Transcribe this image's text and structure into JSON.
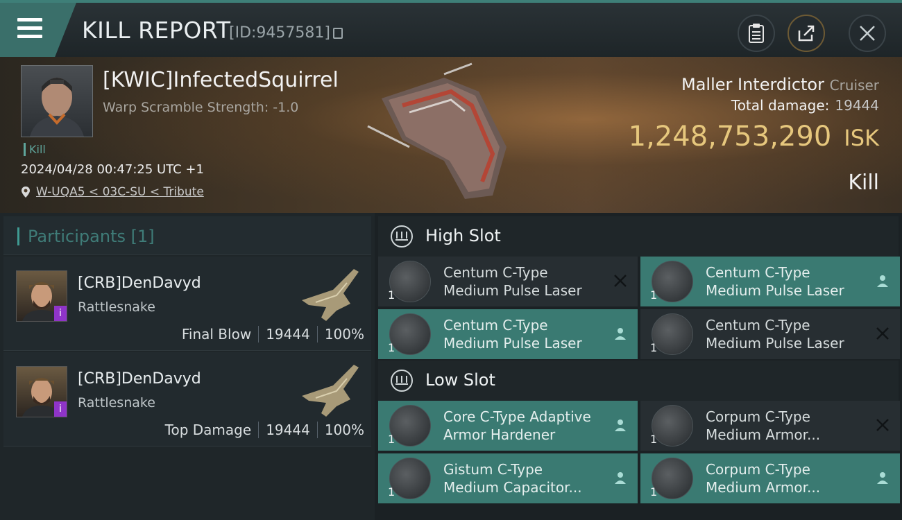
{
  "header": {
    "title": "KILL REPORT",
    "report_id": "[ID:9457581]"
  },
  "victim": {
    "name": "[KWIC]InfectedSquirrel",
    "warp_scramble": "Warp Scramble Strength: -1.0",
    "kill_tag": "Kill",
    "datetime": "2024/04/28 00:47:25 UTC +1",
    "location": "W-UQA5 < 03C-SU < Tribute",
    "ship_name": "Maller Interdictor",
    "ship_class": "Cruiser",
    "total_damage_label": "Total damage:",
    "total_damage": "19444",
    "isk_value": "1,248,753,290",
    "isk_unit": "ISK",
    "result": "Kill"
  },
  "participants": {
    "title": "Participants",
    "count": "[1]",
    "rows": [
      {
        "name": "[CRB]DenDavyd",
        "ship": "Rattlesnake",
        "role": "Final Blow",
        "damage": "19444",
        "percent": "100%"
      },
      {
        "name": "[CRB]DenDavyd",
        "ship": "Rattlesnake",
        "role": "Top Damage",
        "damage": "19444",
        "percent": "100%"
      }
    ]
  },
  "fitting": {
    "high_slot_title": "High Slot",
    "low_slot_title": "Low Slot",
    "high": [
      {
        "qty": "1",
        "name": "Centum C-Type\nMedium Pulse Laser",
        "status": "destroyed"
      },
      {
        "qty": "1",
        "name": "Centum C-Type\nMedium Pulse Laser",
        "status": "dropped"
      },
      {
        "qty": "1",
        "name": "Centum C-Type\nMedium Pulse Laser",
        "status": "dropped"
      },
      {
        "qty": "1",
        "name": "Centum C-Type\nMedium Pulse Laser",
        "status": "destroyed"
      }
    ],
    "low": [
      {
        "qty": "1",
        "name": "Core C-Type Adaptive\n Armor Hardener",
        "status": "dropped"
      },
      {
        "qty": "1",
        "name": "Corpum C-Type\nMedium Armor...",
        "status": "destroyed"
      },
      {
        "qty": "1",
        "name": "Gistum C-Type\nMedium Capacitor...",
        "status": "dropped"
      },
      {
        "qty": "1",
        "name": "Corpum C-Type\nMedium Armor...",
        "status": "dropped"
      }
    ]
  },
  "colors": {
    "accent": "#3a7a72",
    "isk": "#e6c77d",
    "corp_badge": "#8f34c8"
  }
}
